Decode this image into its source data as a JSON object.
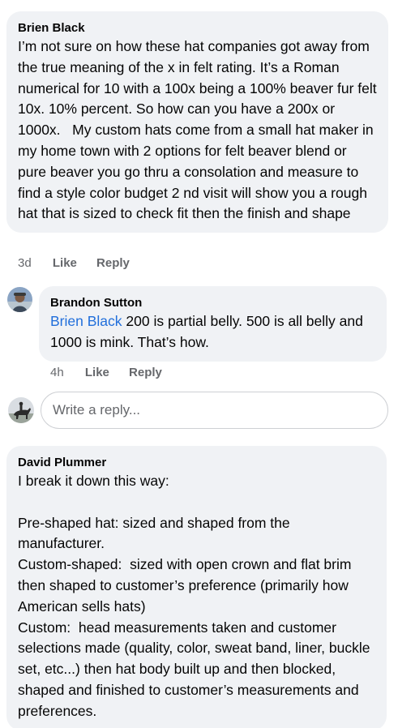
{
  "comments": [
    {
      "author": "Brien Black",
      "text": "I’m not sure on how these hat companies got away from the true meaning of the x in felt rating. It’s a Roman numerical for 10 with a 100x being a 100% beaver fur felt 10x. 10% percent. So how can you have a 200x or 1000x.   My custom hats come from a small hat maker in my home town with 2 options for felt beaver blend or pure beaver you go thru a consolation and measure to find a style color budget 2 nd visit will show you a rough hat that is sized to check fit then the finish and shape",
      "time": "3d",
      "like_label": "Like",
      "reply_label": "Reply"
    },
    {
      "author": "Brandon Sutton",
      "mention": "Brien Black",
      "text": " 200 is partial belly. 500 is all belly and 1000 is mink. That’s how.",
      "time": "4h",
      "like_label": "Like",
      "reply_label": "Reply"
    },
    {
      "author": "David Plummer",
      "text": "I break it down this way:\n\nPre-shaped hat: sized and shaped from the manufacturer.\nCustom-shaped:  sized with open crown and flat brim then shaped to customer’s preference (primarily how American sells hats)\nCustom:  head measurements taken and customer selections made (quality, color, sweat band, liner, buckle set, etc...) then hat body built up and then blocked, shaped and finished to customer’s measurements and preferences."
    }
  ],
  "reply_box": {
    "placeholder": "Write a reply..."
  }
}
